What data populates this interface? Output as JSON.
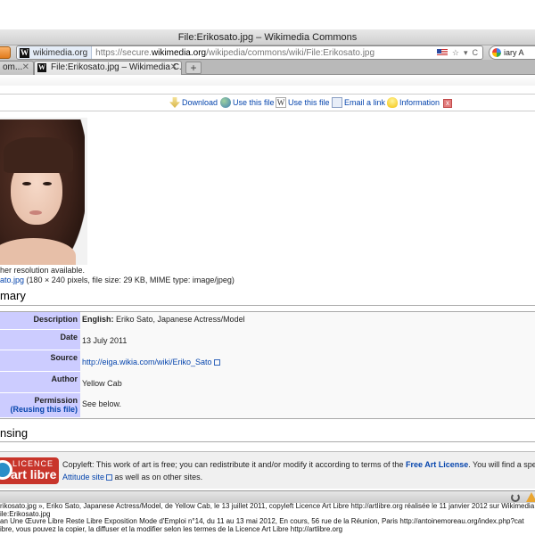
{
  "window": {
    "title": "File:Erikosato.jpg – Wikimedia Commons"
  },
  "urlbar": {
    "site": "wikimedia.org",
    "url_prefix": "https://secure.",
    "url_domain": "wikimedia.org",
    "url_path": "/wikipedia/commons/wiki/File:Erikosato.jpg",
    "bookmark_star": "☆",
    "dropdown": "▾",
    "reload": "C"
  },
  "searchbar": {
    "text": "iary A"
  },
  "tabs": [
    {
      "label": "om...",
      "close": "✕"
    },
    {
      "label": "File:Erikosato.jpg – Wikimedia C...",
      "close": "✕"
    }
  ],
  "newtab": "+",
  "actions": {
    "download": "Download",
    "use_file_1": "Use this file",
    "use_file_2": "Use this file",
    "email": "Email a link",
    "information": "Information",
    "close": "x"
  },
  "file": {
    "higher_res": "her resolution available.",
    "link": "ato.jpg",
    "meta": " (180 × 240 pixels, file size: 29 KB, MIME type: image/jpeg)"
  },
  "summary": {
    "heading": "mary",
    "rows": {
      "description": {
        "label": "Description",
        "lang": "English:",
        "value": " Eriko Sato, Japanese Actress/Model"
      },
      "date": {
        "label": "Date",
        "value": "13 July 2011"
      },
      "source": {
        "label": "Source",
        "value": "http://eiga.wikia.com/wiki/Eriko_Sato"
      },
      "author": {
        "label": "Author",
        "value": "Yellow Cab"
      },
      "permission": {
        "label": "Permission",
        "sublabel": "(Reusing this file)",
        "value": "See below."
      }
    }
  },
  "licensing": {
    "heading": "nsing",
    "logo_top": "LICENCE",
    "logo_bottom": "art libre",
    "text_start": "Copyleft: This work of art is free; you can redistribute it and/or modify it according to terms of the ",
    "license_link": "Free Art License",
    "text_end": ". You will find a specimen of this",
    "line2_link": "Attitude site",
    "line2_rest": " as well as on other sites."
  },
  "metadata": {
    "line1": "rikosato.jpg », Eriko Sato, Japanese Actress/Model, de Yellow Cab, le 13 juillet 2011, copyleft Licence Art Libre http://artlibre.org réalisée le 11 janvier 2012 sur Wikimedia",
    "line2": "ile:Erikosato.jpg",
    "line3": "an Une Œuvre Libre Reste Libre  Exposition Mode d'Emploi n°14, du 11 au 13 mai 2012, En cours, 56 rue de la Réunion, Paris  http://antoinemoreau.org/index.php?cat",
    "line4": "ibre, vous pouvez la copier, la diffuser et la modifier selon les termes de la Licence Art Libre http://artlibre.org"
  },
  "colors": {
    "link": "#0645ad",
    "label_bg": "#ccccff",
    "license_red": "#c8352b"
  }
}
